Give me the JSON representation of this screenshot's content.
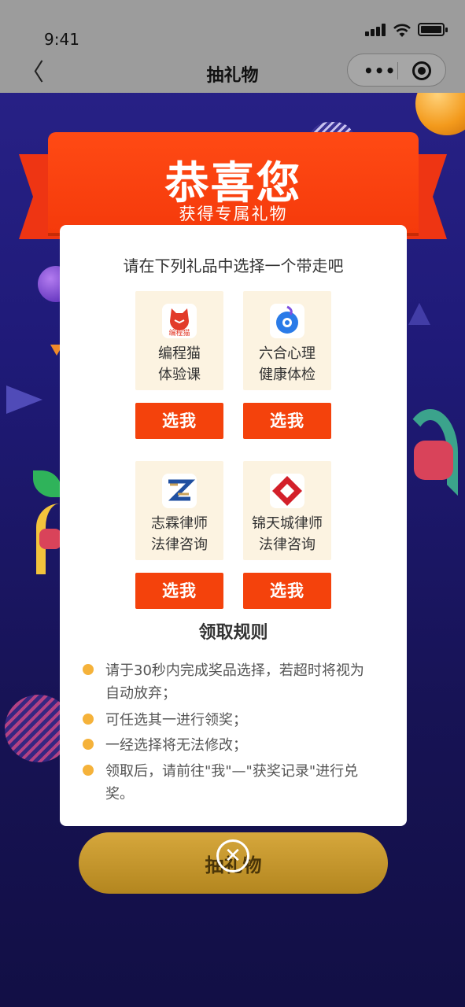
{
  "status_bar": {
    "time": "9:41"
  },
  "nav": {
    "back_glyph": "〈",
    "title": "抽礼物",
    "more_glyph": "•••"
  },
  "ribbon": {
    "title": "恭喜您",
    "subtitle": "获得专属礼物"
  },
  "modal": {
    "prompt": "请在下列礼品中选择一个带走吧",
    "gifts": [
      {
        "name_line1": "编程猫",
        "name_line2": "体验课",
        "logo_text": "编程猫",
        "icon": "codemao-logo-icon",
        "button": "选我"
      },
      {
        "name_line1": "六合心理",
        "name_line2": "健康体检",
        "icon": "liuhe-logo-icon",
        "button": "选我"
      },
      {
        "name_line1": "志霖律师",
        "name_line2": "法律咨询",
        "icon": "zhilin-logo-icon",
        "button": "选我"
      },
      {
        "name_line1": "锦天城律师",
        "name_line2": "法律咨询",
        "icon": "jintiancheng-logo-icon",
        "button": "选我"
      }
    ],
    "rules_title": "领取规则",
    "rules": [
      {
        "line1": "请于30秒内完成奖品选择，若超时将视为",
        "line2": "自动放弃；"
      },
      {
        "line1": "可任选其一进行领奖；"
      },
      {
        "line1": "一经选择将无法修改；"
      },
      {
        "line1": "领取后，请前往\"我\"—\"获奖记录\"进行兑",
        "line2": "奖。"
      }
    ]
  },
  "background": {
    "button_label": "抽礼物"
  },
  "close_glyph": "✕",
  "colors": {
    "ribbon": "#f53a0b",
    "pick_button": "#f4420c",
    "card_bg": "#fcf3e1",
    "rule_dot": "#f5b23a",
    "page_bg": "#1f1a78"
  }
}
